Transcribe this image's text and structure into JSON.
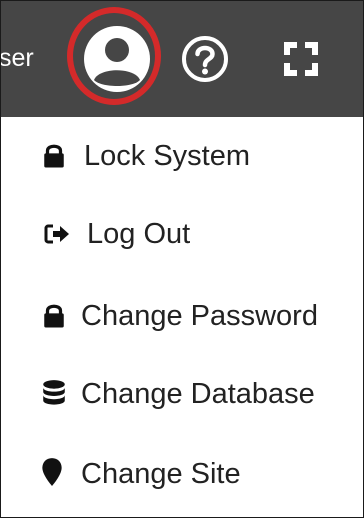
{
  "header": {
    "user_label": "ser",
    "icons": [
      "user-circle-icon",
      "help-circle-icon",
      "fullscreen-icon"
    ],
    "highlight_color": "#d42a2a",
    "bar_color": "#464646"
  },
  "menu": {
    "items": [
      {
        "label": "Lock System",
        "icon": "lock-icon"
      },
      {
        "label": "Log Out",
        "icon": "sign-out-icon"
      },
      {
        "label": "Change Password",
        "icon": "lock-icon"
      },
      {
        "label": "Change Database",
        "icon": "database-icon"
      },
      {
        "label": "Change Site",
        "icon": "map-marker-icon"
      }
    ]
  }
}
